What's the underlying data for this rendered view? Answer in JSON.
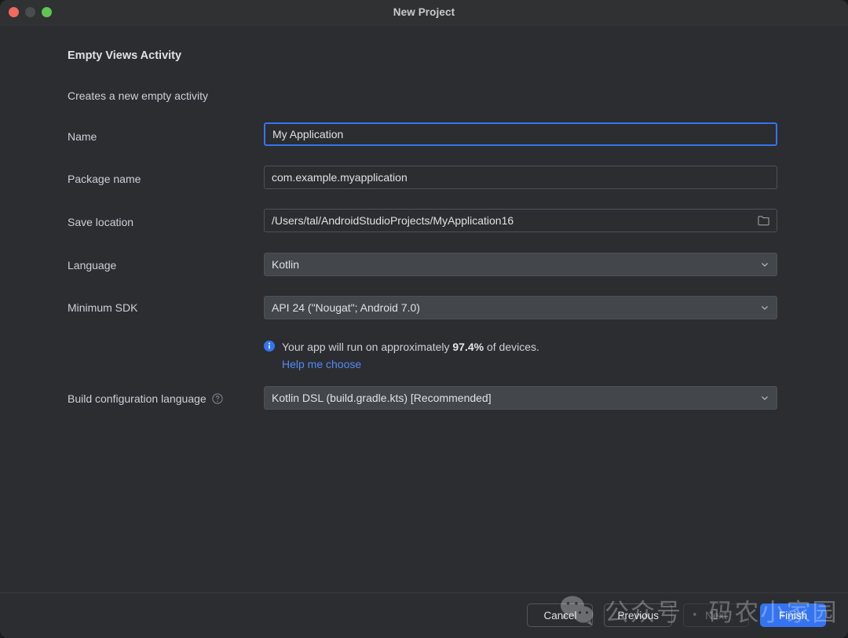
{
  "window": {
    "title": "New Project",
    "traffic_lights": [
      "close-button",
      "minimize-button",
      "zoom-button"
    ]
  },
  "template": {
    "name": "Empty Views Activity",
    "description": "Creates a new empty activity"
  },
  "form": {
    "rows": [
      {
        "label": "Name",
        "value": "My Application",
        "type": "text",
        "focused": true
      },
      {
        "label": "Package name",
        "value": "com.example.myapplication",
        "type": "text",
        "focused": false
      },
      {
        "label": "Save location",
        "value": "/Users/tal/AndroidStudioProjects/MyApplication16",
        "type": "path",
        "focused": false
      },
      {
        "label": "Language",
        "value": "Kotlin",
        "type": "combo",
        "focused": false
      },
      {
        "label": "Minimum SDK",
        "value": "API 24 (\"Nougat\"; Android 7.0)",
        "type": "combo",
        "focused": false
      },
      {
        "label": "Build configuration language",
        "value": "Kotlin DSL (build.gradle.kts) [Recommended]",
        "type": "combo",
        "focused": false,
        "help": true
      }
    ]
  },
  "sdk_note": {
    "prefix": "Your app will run on approximately ",
    "percent": "97.4%",
    "suffix": " of devices.",
    "link": "Help me choose"
  },
  "footer": {
    "cancel": "Cancel",
    "previous": "Previous",
    "next": "Next",
    "finish": "Finish"
  },
  "watermark": {
    "text": "公众号 · 码农小家园"
  },
  "colors": {
    "accent": "#3574f0",
    "link": "#548af7",
    "dialog_bg": "#2b2d30",
    "titlebar_bg": "#2f3133",
    "combo_bg": "#43464a",
    "border": "#4e5157",
    "text": "#ced0d6",
    "close": "#ef6a5f",
    "minimize": "#4a4d50",
    "zoom": "#61c554"
  }
}
